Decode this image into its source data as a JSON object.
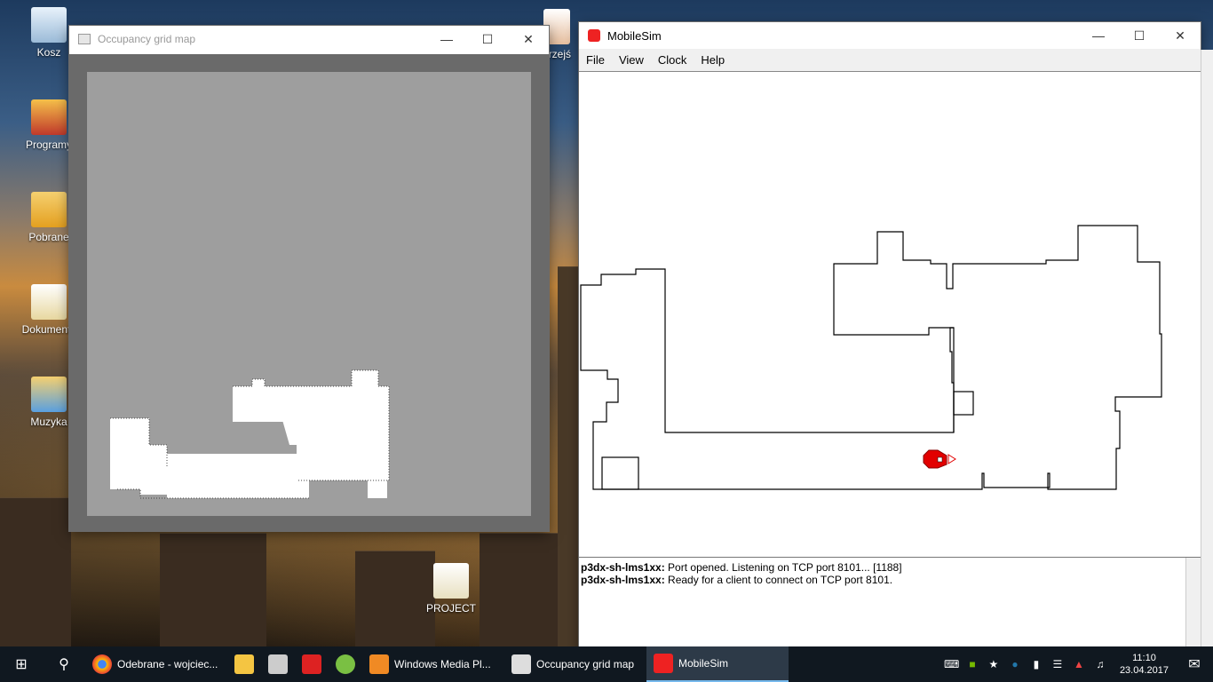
{
  "desktop": {
    "icons": [
      {
        "label": "Kosz"
      },
      {
        "label": "Programy"
      },
      {
        "label": "Pobrane"
      },
      {
        "label": "Dokumenty"
      },
      {
        "label": "Muzyka"
      },
      {
        "label": "PROJECT"
      },
      {
        "label": "przejś"
      }
    ]
  },
  "occupancy_window": {
    "title": "Occupancy grid map"
  },
  "mobilesim_window": {
    "title": "MobileSim",
    "menu": [
      "File",
      "View",
      "Clock",
      "Help"
    ],
    "log": [
      {
        "source": "p3dx-sh-lms1xx:",
        "message": "Port opened. Listening on TCP port 8101... [1188]"
      },
      {
        "source": "p3dx-sh-lms1xx:",
        "message": "Ready for a client to connect on TCP port 8101."
      }
    ]
  },
  "taskbar": {
    "items": [
      {
        "label": "Odebrane - wojciec...",
        "icon": "chrome-icon",
        "color": "#e8b020"
      },
      {
        "label": "",
        "icon": "file-explorer-icon",
        "color": "#f4c542"
      },
      {
        "label": "",
        "icon": "calendar-app-icon",
        "color": "#cccccc"
      },
      {
        "label": "",
        "icon": "flash-icon",
        "color": "#d22"
      },
      {
        "label": "",
        "icon": "utorrent-icon",
        "color": "#7ac043"
      },
      {
        "label": "Windows Media Pl...",
        "icon": "media-player-icon",
        "color": "#f08a24"
      },
      {
        "label": "Occupancy grid map",
        "icon": "window-icon",
        "color": "#dddddd"
      },
      {
        "label": "MobileSim",
        "icon": "mobilesim-icon",
        "color": "#e22"
      }
    ],
    "time": "11:10",
    "date": "23.04.2017"
  }
}
